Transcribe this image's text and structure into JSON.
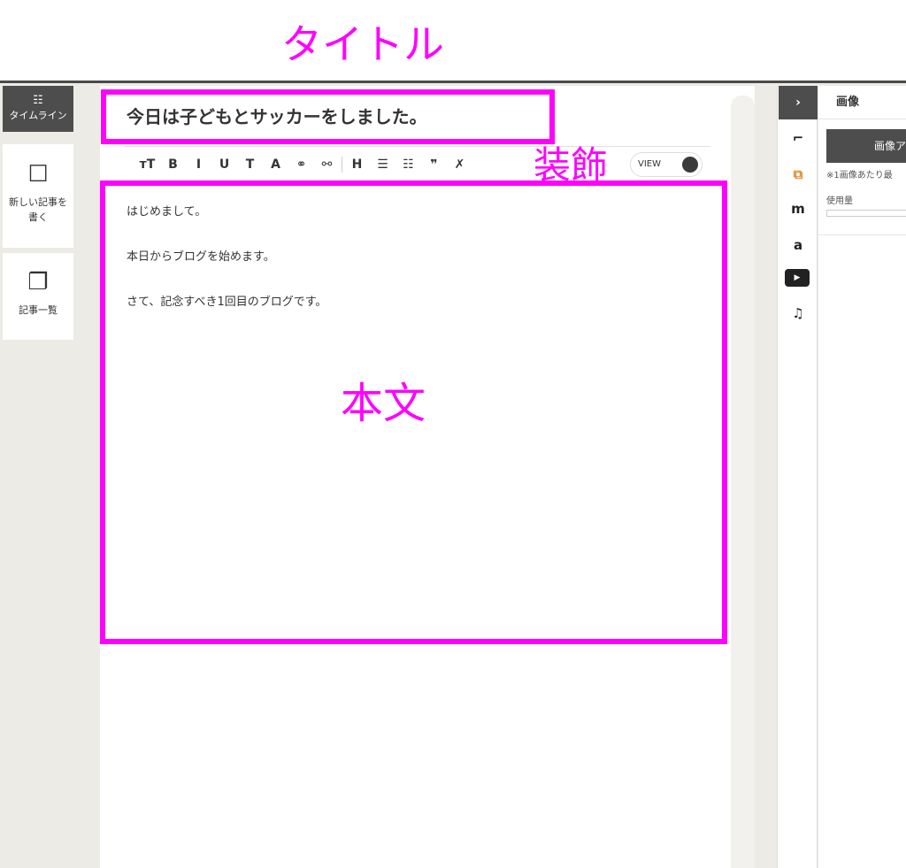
{
  "annotations": {
    "title": "タイトル",
    "decoration": "装飾",
    "body": "本文"
  },
  "left_sidebar": {
    "timeline": {
      "icon": "timeline-icon",
      "label": "タイムライン"
    },
    "new_post": {
      "icon": "edit-icon",
      "label": "新しい記事を書く"
    },
    "post_list": {
      "icon": "documents-icon",
      "label": "記事一覧"
    }
  },
  "editor": {
    "title": "今日は子どもとサッカーをしました。",
    "toolbar": [
      {
        "name": "font-size-icon",
        "glyph": "тT"
      },
      {
        "name": "bold-icon",
        "glyph": "B"
      },
      {
        "name": "italic-icon",
        "glyph": "I"
      },
      {
        "name": "underline-icon",
        "glyph": "U"
      },
      {
        "name": "strikethrough-icon",
        "glyph": "T"
      },
      {
        "name": "text-color-icon",
        "glyph": "A"
      },
      {
        "name": "link-icon",
        "glyph": "⚭"
      },
      {
        "name": "unlink-icon",
        "glyph": "⚯"
      },
      {
        "name": "heading-icon",
        "glyph": "H"
      },
      {
        "name": "ordered-list-icon",
        "glyph": "☰"
      },
      {
        "name": "bullet-list-icon",
        "glyph": "☷"
      },
      {
        "name": "quote-icon",
        "glyph": "❞"
      },
      {
        "name": "clear-format-icon",
        "glyph": "✗"
      }
    ],
    "view_label": "VIEW",
    "body_lines": [
      "はじめまして。",
      "本日からブログを始めます。",
      "さて、記念すべき1回目のブログです。"
    ]
  },
  "right_sidebar": {
    "collapse_icon": "chevron-right-icon",
    "collapse_glyph": "›",
    "tools": [
      {
        "name": "frame-icon",
        "glyph": "⌐",
        "color": "#222222"
      },
      {
        "name": "image-gallery-icon",
        "glyph": "⧉",
        "color": "#e08a2a"
      },
      {
        "name": "mercari-icon",
        "glyph": "m",
        "color": "#222222"
      },
      {
        "name": "amazon-icon",
        "glyph": "a",
        "color": "#222222"
      },
      {
        "name": "youtube-icon",
        "glyph": "▶",
        "color": "#222222"
      },
      {
        "name": "music-icon",
        "glyph": "♫",
        "color": "#222222"
      }
    ]
  },
  "image_panel": {
    "title": "画像",
    "button_label": "画像ア",
    "note": "※1画像あたり最",
    "usage_label": "使用量",
    "usage_fraction": 0
  },
  "colors": {
    "annotation": "#ff00ff",
    "dark_bar": "#4d4d4d",
    "accent_orange": "#e08a2a"
  }
}
